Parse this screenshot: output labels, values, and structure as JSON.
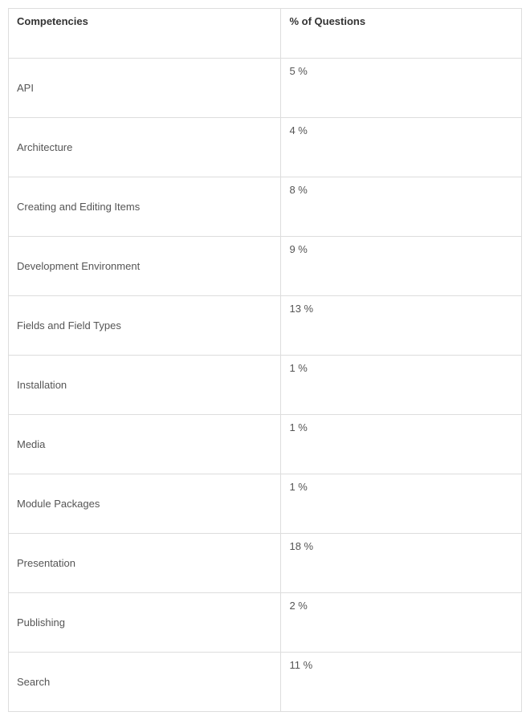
{
  "headers": {
    "left": "Competencies",
    "right": "% of Questions"
  },
  "rows": [
    {
      "name": "API",
      "percent": "5 %"
    },
    {
      "name": "Architecture",
      "percent": "4 %"
    },
    {
      "name": "Creating and Editing Items",
      "percent": "8 %"
    },
    {
      "name": "Development Environment",
      "percent": "9 %"
    },
    {
      "name": "Fields and Field Types",
      "percent": "13 %"
    },
    {
      "name": "Installation",
      "percent": "1 %"
    },
    {
      "name": "Media",
      "percent": "1 %"
    },
    {
      "name": "Module Packages",
      "percent": "1 %"
    },
    {
      "name": "Presentation",
      "percent": "18 %"
    },
    {
      "name": "Publishing",
      "percent": "2 %"
    },
    {
      "name": "Search",
      "percent": "11 %"
    }
  ]
}
